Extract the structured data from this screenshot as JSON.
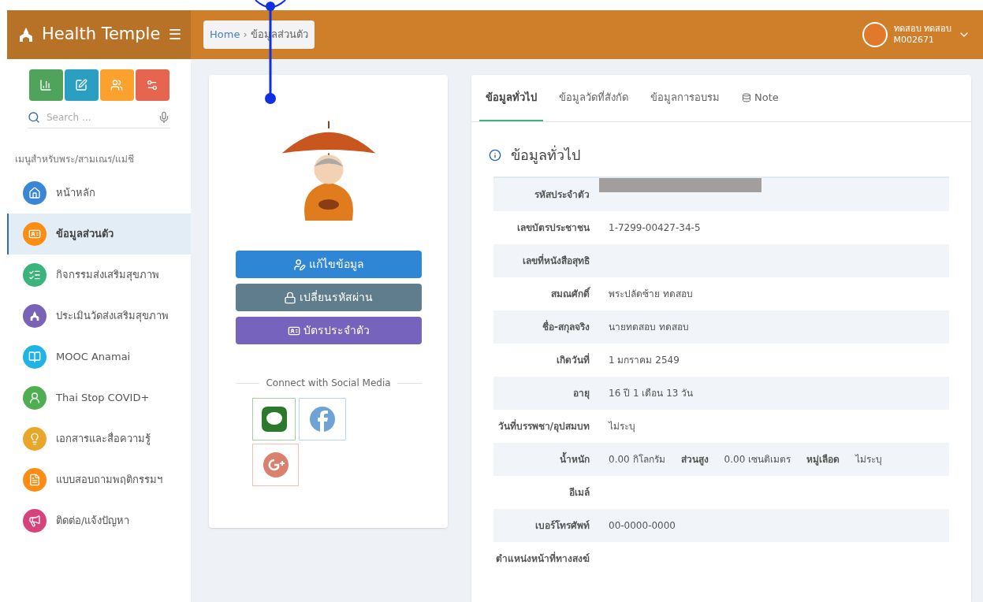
{
  "header": {
    "brand": "Health Temple",
    "menu_glyph": "☰",
    "breadcrumb_separator": "›",
    "breadcrumb": [
      {
        "label": "Home",
        "kind": "link"
      },
      {
        "label": "ข้อมูลส่วนตัว",
        "kind": "current"
      }
    ],
    "user": {
      "name": "ทดสอบ ทดสอบ",
      "code": "M002671"
    }
  },
  "sidebar": {
    "quick_buttons": [
      {
        "kind": "chart",
        "color": "#4fa35a"
      },
      {
        "kind": "edit",
        "color": "#2b9fc2"
      },
      {
        "kind": "group",
        "color": "#fba12e"
      },
      {
        "kind": "gears",
        "color": "#e5654f"
      }
    ],
    "search": {
      "placeholder": "Search ..."
    },
    "section_title": "เมนูสำหรับพระ/สามเณร/แม่ชี",
    "items": [
      {
        "label": "หน้าหลัก",
        "kind": "home",
        "color": "#3a86d6",
        "selected": false
      },
      {
        "label": "ข้อมูลส่วนตัว",
        "kind": "idcard",
        "color": "#fb8c14",
        "selected": true
      },
      {
        "label": "กิจกรรมส่งเสริมสุขภาพ",
        "kind": "list",
        "color": "#3bb37d",
        "selected": false
      },
      {
        "label": "ประเมินวัดส่งเสริมสุขภาพ",
        "kind": "temple",
        "color": "#7a62b8",
        "selected": false
      },
      {
        "label": "MOOC Anamai",
        "kind": "book",
        "color": "#1fb3e6",
        "selected": false
      },
      {
        "label": "Thai Stop COVID+",
        "kind": "doctor",
        "color": "#4fae52",
        "selected": false
      },
      {
        "label": "เอกสารและสื่อความรู้",
        "kind": "bulb",
        "color": "#e8a62a",
        "selected": false
      },
      {
        "label": "แบบสอบถามพฤติกรรมฯ",
        "kind": "file",
        "color": "#fb8c14",
        "selected": false
      },
      {
        "label": "ติดต่อ/แจ้งปัญหา",
        "kind": "megaphone",
        "color": "#d6437a",
        "selected": false
      }
    ]
  },
  "profile_card": {
    "buttons": [
      {
        "label": "แก้ไขข้อมูล",
        "kind": "edit"
      },
      {
        "label": "เปลี่ยนรหัสผ่าน",
        "kind": "password"
      },
      {
        "label": "บัตรประจำตัว",
        "kind": "card"
      }
    ],
    "social_title": "Connect with Social Media",
    "social": [
      {
        "kind": "line"
      },
      {
        "kind": "facebook"
      },
      {
        "kind": "google"
      }
    ]
  },
  "tabs": [
    {
      "label": "ข้อมูลทั่วไป",
      "selected": true
    },
    {
      "label": "ข้อมูลวัดที่สังกัด",
      "selected": false
    },
    {
      "label": "ข้อมูลการอบรม",
      "selected": false
    },
    {
      "label": "Note",
      "selected": false,
      "kind": "note"
    }
  ],
  "section_heading": "ข้อมูลทั่วไป",
  "rows": [
    {
      "label": "รหัสประจำตัว",
      "kind": "redacted"
    },
    {
      "label": "เลขบัตรประชาชน",
      "kind": "text",
      "value": "1-7299-00427-34-5"
    },
    {
      "label": "เลขที่หนังสือสุทธิ",
      "kind": "text"
    },
    {
      "label": "สมณศักดิ์",
      "kind": "text",
      "value": "พระปลัดซ้าย ทดสอบ"
    },
    {
      "label": "ชื่อ-สกุลจริง",
      "kind": "text",
      "value": "นายทดสอบ ทดสอบ"
    },
    {
      "label": "เกิดวันที่",
      "kind": "text",
      "value": "1 มกราคม 2549"
    },
    {
      "label": "อายุ",
      "kind": "text",
      "value": "16 ปี 1 เดือน 13 วัน"
    },
    {
      "label": "วันที่บรรพชา/อุปสมบท",
      "kind": "text",
      "value": "ไม่ระบุ"
    },
    {
      "label": "น้ำหนัก",
      "kind": "multi",
      "parts": [
        {
          "value": "0.00 กิโลกรัม"
        },
        {
          "label": "ส่วนสูง",
          "value": "0.00 เซนติเมตร"
        },
        {
          "label": "หมู่เลือด",
          "value": "ไม่ระบุ"
        }
      ]
    },
    {
      "label": "อีเมล์",
      "kind": "text"
    },
    {
      "label": "เบอร์โทรศัพท์",
      "kind": "text",
      "value": "00-0000-0000"
    },
    {
      "label": "ตำแหน่งหน้าที่ทางสงฆ์",
      "kind": "text"
    }
  ]
}
